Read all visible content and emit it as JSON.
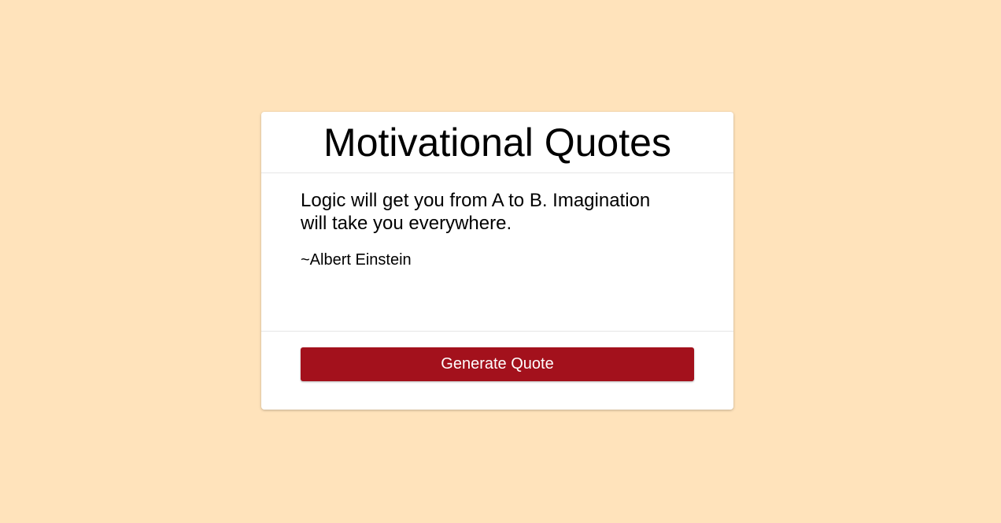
{
  "app": {
    "title": "Motivational Quotes"
  },
  "quote": {
    "text": "Logic will get you from A to B. Imagination will take you everywhere.",
    "author": "~Albert Einstein"
  },
  "actions": {
    "generate_label": "Generate Quote"
  },
  "colors": {
    "background": "#ffe3bb",
    "card": "#ffffff",
    "button": "#a3111c",
    "button_text": "#ffffff"
  }
}
